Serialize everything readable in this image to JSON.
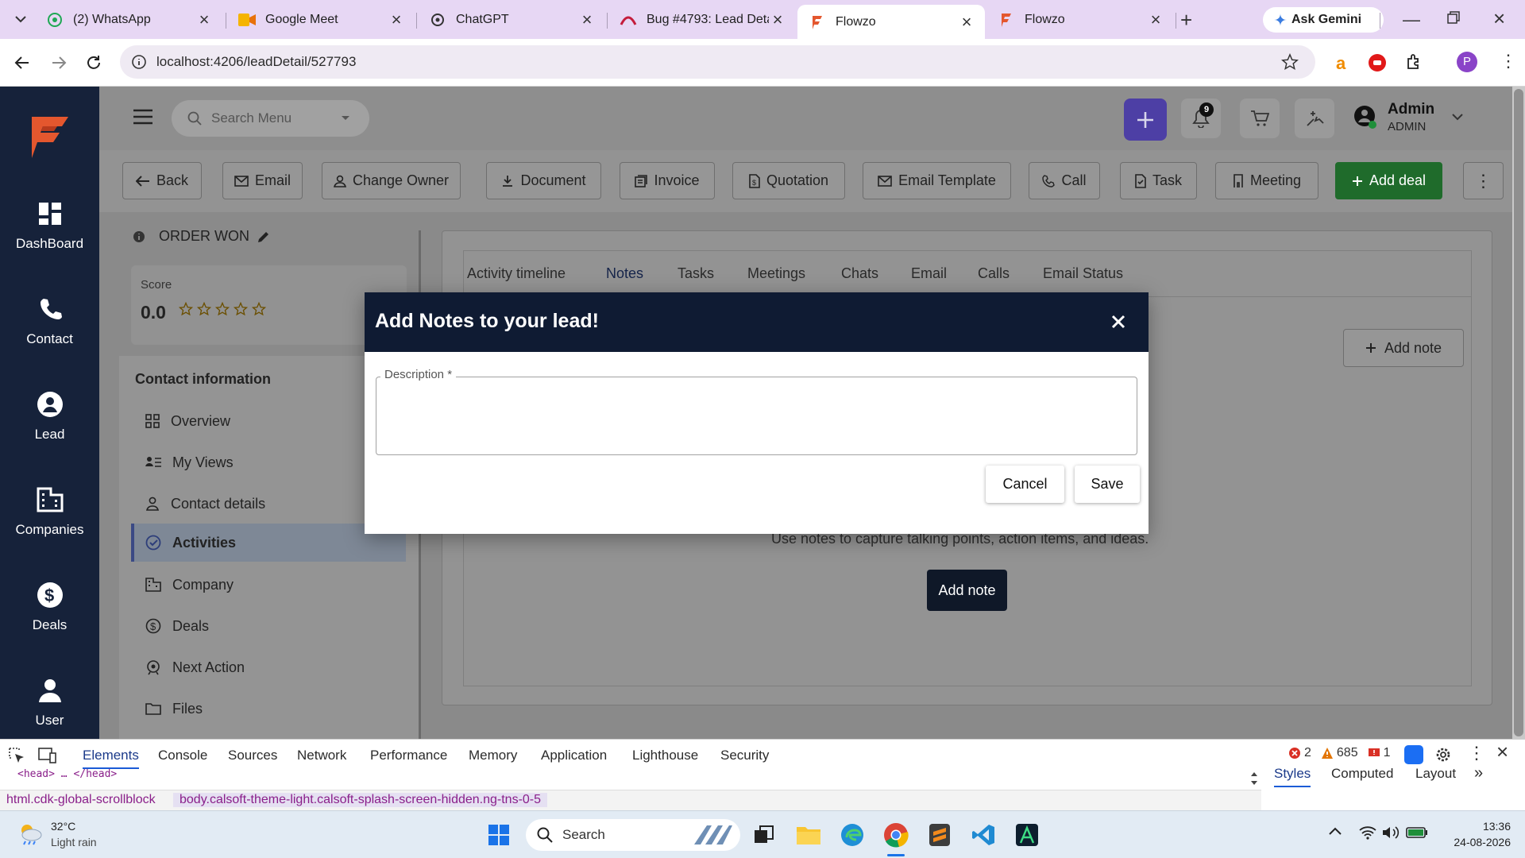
{
  "browser": {
    "tabs": [
      {
        "title": "(2) WhatsApp",
        "icon": "whatsapp-icon"
      },
      {
        "title": "Google Meet",
        "icon": "google-meet-icon"
      },
      {
        "title": "ChatGPT",
        "icon": "chatgpt-icon"
      },
      {
        "title": "Bug #4793: Lead Detai",
        "icon": "azure-devops-icon"
      },
      {
        "title": "Flowzo",
        "icon": "flowzo-icon",
        "active": true
      },
      {
        "title": "Flowzo",
        "icon": "flowzo-icon"
      }
    ],
    "new_tab": "+",
    "gemini_label": "Ask Gemini",
    "url": "localhost:4206/leadDetail/527793",
    "profile_initial": "P"
  },
  "sidebar": {
    "items": [
      {
        "label": "DashBoard",
        "icon": "dashboard-icon"
      },
      {
        "label": "Contact",
        "icon": "phone-icon"
      },
      {
        "label": "Lead",
        "icon": "user-circle-icon"
      },
      {
        "label": "Companies",
        "icon": "building-icon"
      },
      {
        "label": "Deals",
        "icon": "dollar-icon"
      },
      {
        "label": "User",
        "icon": "user-icon"
      }
    ]
  },
  "header": {
    "search_placeholder": "Search Menu",
    "notification_count": "9",
    "user_name": "Admin",
    "user_role": "ADMIN"
  },
  "actions": {
    "buttons": [
      "Back",
      "Email",
      "Change Owner",
      "Document",
      "Invoice",
      "Quotation",
      "Email Template",
      "Call",
      "Task",
      "Meeting",
      "Add deal"
    ]
  },
  "lead": {
    "status": "ORDER WON",
    "score_label": "Score",
    "score_value": "0.0",
    "stars": 5,
    "contact_section_title": "Contact information",
    "menu": [
      {
        "label": "Overview",
        "icon": "grid-icon"
      },
      {
        "label": "My Views",
        "icon": "list-person-icon"
      },
      {
        "label": "Contact details",
        "icon": "person-icon"
      },
      {
        "label": "Activities",
        "icon": "check-circle-icon",
        "active": true
      },
      {
        "label": "Company",
        "icon": "company-icon"
      },
      {
        "label": "Deals",
        "icon": "dollar-circle-icon"
      },
      {
        "label": "Next Action",
        "icon": "next-action-icon"
      },
      {
        "label": "Files",
        "icon": "folder-icon"
      }
    ]
  },
  "activity_tabs": [
    "Activity timeline",
    "Notes",
    "Tasks",
    "Meetings",
    "Chats",
    "Email",
    "Calls",
    "Email Status"
  ],
  "notes": {
    "add_note_top": "Add note",
    "empty_text": "Use notes to capture talking points, action items, and ideas.",
    "add_note_button": "Add note"
  },
  "modal": {
    "title": "Add Notes to your lead!",
    "description_label": "Description *",
    "description_value": "",
    "cancel_label": "Cancel",
    "save_label": "Save"
  },
  "devtools": {
    "tabs": [
      "Elements",
      "Console",
      "Sources",
      "Network",
      "Performance",
      "Memory",
      "Application",
      "Lighthouse",
      "Security"
    ],
    "active_tab": "Elements",
    "errors": "2",
    "warnings": "685",
    "issues": "1",
    "code_line": "<head> … </head>",
    "breadcrumbs": [
      "html.cdk-global-scrollblock",
      "body.calsoft-theme-light.calsoft-splash-screen-hidden.ng-tns-0-5"
    ],
    "side_tabs": [
      "Styles",
      "Computed",
      "Layout"
    ]
  },
  "taskbar": {
    "weather_temp": "32°C",
    "weather_desc": "Light rain",
    "search_label": "Search",
    "time": "13:36",
    "date": "24-08-2026"
  },
  "colors": {
    "sidebar": "#16223a",
    "modal_header": "#0f1b33",
    "add_deal": "#1f6b2b",
    "plus_button": "#4d3fa5"
  }
}
